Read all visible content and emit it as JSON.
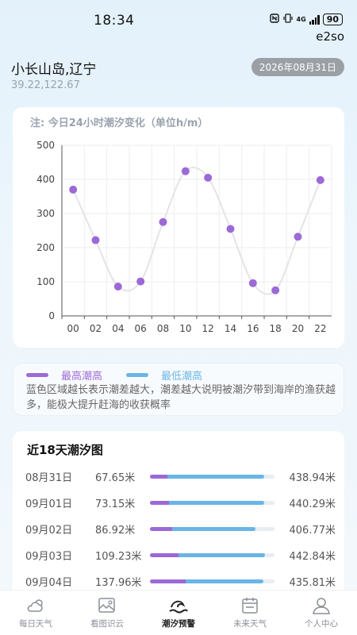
{
  "status_bar": {
    "time": "18:34",
    "network": "4G",
    "battery": "90"
  },
  "brand": "e2so",
  "location": {
    "name": "小长山岛,辽宁",
    "coords": "39.22,122.67",
    "date": "2026年08月31日"
  },
  "chart_note": "注:  今日24小时潮汐变化（单位h/m）",
  "chart_data": {
    "type": "line",
    "title": "注:  今日24小时潮汐变化（单位h/m）",
    "x": [
      "00",
      "02",
      "04",
      "06",
      "08",
      "10",
      "12",
      "14",
      "16",
      "18",
      "20",
      "22"
    ],
    "values": [
      370,
      222,
      86,
      101,
      275,
      424,
      405,
      255,
      96,
      75,
      232,
      398
    ],
    "y_ticks": [
      "0",
      "100",
      "200",
      "300",
      "400",
      "500"
    ],
    "ylim": [
      0,
      500
    ],
    "grid": true,
    "point_color": "#9b6ad7",
    "line_color": "#e4e4e8"
  },
  "legend": {
    "high_label": "最高潮高",
    "low_label": "最低潮高",
    "high_color": "#9b6ad7",
    "low_color": "#6ab5e5",
    "description": "蓝色区域越长表示潮差越大，潮差越大说明被潮汐带到海岸的渔获越多，能极大提升赶海的收获概率"
  },
  "tide_section": {
    "title": "近18天潮汐图",
    "rows": [
      {
        "date": "08月31日",
        "low": "67.65米",
        "high": "438.94米",
        "low_val": 67.65,
        "high_val": 438.94
      },
      {
        "date": "09月01日",
        "low": "73.15米",
        "high": "440.29米",
        "low_val": 73.15,
        "high_val": 440.29
      },
      {
        "date": "09月02日",
        "low": "86.92米",
        "high": "406.77米",
        "low_val": 86.92,
        "high_val": 406.77
      },
      {
        "date": "09月03日",
        "low": "109.23米",
        "high": "442.84米",
        "low_val": 109.23,
        "high_val": 442.84
      },
      {
        "date": "09月04日",
        "low": "137.96米",
        "high": "435.81米",
        "low_val": 137.96,
        "high_val": 435.81
      }
    ]
  },
  "tabs": [
    {
      "label": "每日天气",
      "icon": "weather-icon",
      "active": false
    },
    {
      "label": "看图识云",
      "icon": "cloud-image-icon",
      "active": false
    },
    {
      "label": "潮汐预警",
      "icon": "tide-wave-icon",
      "active": true
    },
    {
      "label": "未来天气",
      "icon": "calendar-icon",
      "active": false
    },
    {
      "label": "个人中心",
      "icon": "person-icon",
      "active": false
    }
  ]
}
